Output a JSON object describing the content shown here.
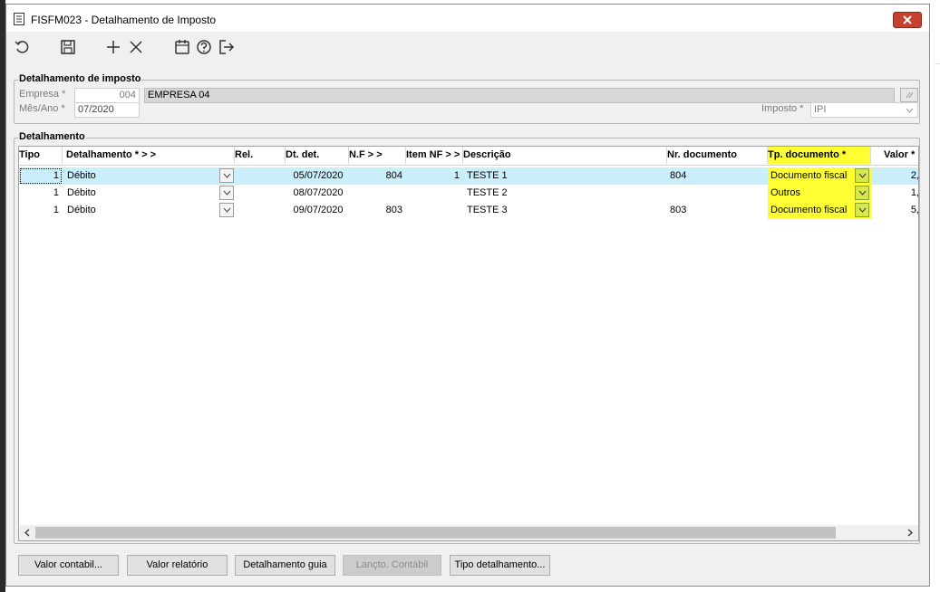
{
  "window": {
    "title": "FISFM023 - Detalhamento de Imposto"
  },
  "toolbar": {
    "icons": [
      "undo-icon",
      "save-icon",
      "add-icon",
      "delete-icon",
      "calendar-icon",
      "help-icon",
      "exit-icon"
    ]
  },
  "header_group": {
    "title": "Detalhamento de imposto",
    "empresa_label": "Empresa *",
    "empresa_code": "004",
    "empresa_name": "EMPRESA 04",
    "mesano_label": "Mês/Ano *",
    "mesano_value": "07/2020",
    "imposto_label": "Imposto *",
    "imposto_value": "IPI"
  },
  "detail_group": {
    "title": "Detalhamento"
  },
  "grid": {
    "columns": {
      "tipo": "Tipo",
      "detalhamento": "Detalhamento *  > >",
      "rel": "Rel.",
      "dtdet": "Dt. det.",
      "nf": "N.F  > >",
      "itemnf": "Item NF  > >",
      "descricao": "Descrição",
      "nrdoc": "Nr. documento",
      "tpdoc": "Tp. documento  *",
      "valor": "Valor  *"
    },
    "rows": [
      {
        "tipo": "1",
        "detalhamento": "Débito",
        "rel": "",
        "dtdet": "05/07/2020",
        "nf": "804",
        "itemnf": "1",
        "descricao": "TESTE 1",
        "nrdoc": "804",
        "tpdoc": "Documento fiscal",
        "valor": "2,"
      },
      {
        "tipo": "1",
        "detalhamento": "Débito",
        "rel": "",
        "dtdet": "08/07/2020",
        "nf": "",
        "itemnf": "",
        "descricao": "TESTE 2",
        "nrdoc": "",
        "tpdoc": "Outros",
        "valor": "1,"
      },
      {
        "tipo": "1",
        "detalhamento": "Débito",
        "rel": "",
        "dtdet": "09/07/2020",
        "nf": "803",
        "itemnf": "",
        "descricao": "TESTE 3",
        "nrdoc": "803",
        "tpdoc": "Documento fiscal",
        "valor": "5,"
      }
    ]
  },
  "buttons": {
    "valor_contabil": "Valor contabil...",
    "valor_relatorio": "Valor relatório",
    "detalhamento_guia": "Detalhamento guia",
    "lancto_contabil": "Lançto. Contábil",
    "tipo_detalhamento": "Tipo detalhamento..."
  },
  "colors": {
    "highlight": "#ffff33",
    "selected_row": "#cbeefb",
    "close_button": "#c7412f"
  }
}
